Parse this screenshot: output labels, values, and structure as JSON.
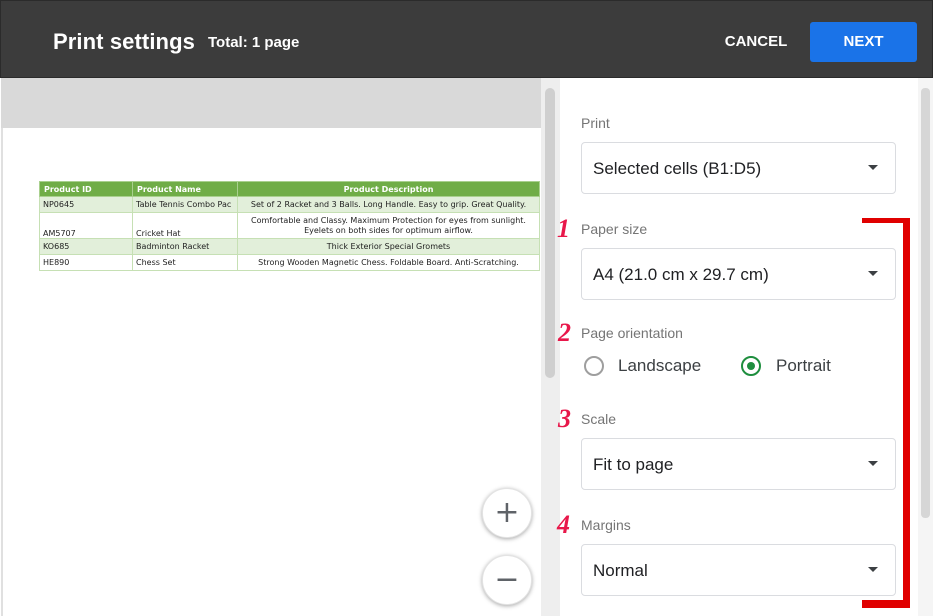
{
  "header": {
    "title": "Print settings",
    "total": "Total: 1 page",
    "cancel_label": "CANCEL",
    "next_label": "NEXT"
  },
  "sheet": {
    "columns": [
      "Product ID",
      "Product Name",
      "Product Description"
    ],
    "rows": [
      {
        "id": "NP0645",
        "name": "Table Tennis Combo Pac",
        "desc": [
          "Set of 2 Racket and 3 Balls. Long Handle. Easy to grip. Great Quality."
        ]
      },
      {
        "id": "AM5707",
        "name": "Cricket Hat",
        "desc": [
          "Comfortable and Classy. Maximum Protection for eyes from sunlight.",
          "Eyelets on both sides for optimum airflow."
        ]
      },
      {
        "id": "KO685",
        "name": "Badminton Racket",
        "desc": [
          "Thick Exterior Special Gromets"
        ]
      },
      {
        "id": "HE890",
        "name": "Chess Set",
        "desc": [
          "Strong Wooden Magnetic Chess.  Foldable Board. Anti-Scratching."
        ]
      }
    ]
  },
  "zoom": {
    "in_symbol": "+",
    "out_symbol": "−"
  },
  "settings": {
    "print_label": "Print",
    "print_value": "Selected cells (B1:D5)",
    "paper_size_label": "Paper size",
    "paper_size_value": "A4 (21.0 cm x 29.7 cm)",
    "orientation_label": "Page orientation",
    "orientation_options": [
      "Landscape",
      "Portrait"
    ],
    "orientation_selected": "Portrait",
    "scale_label": "Scale",
    "scale_value": "Fit to page",
    "margins_label": "Margins",
    "margins_value": "Normal"
  },
  "annotations": {
    "numbers": [
      "1",
      "2",
      "3",
      "4"
    ],
    "color": "#e8174a",
    "bracket_color": "#e00000"
  },
  "colors": {
    "header_bg": "#3c3c3c",
    "next_button": "#1a73e8",
    "table_header": "#70ad47",
    "table_alt_row": "#e2efda",
    "radio_selected": "#1e8e3e"
  }
}
